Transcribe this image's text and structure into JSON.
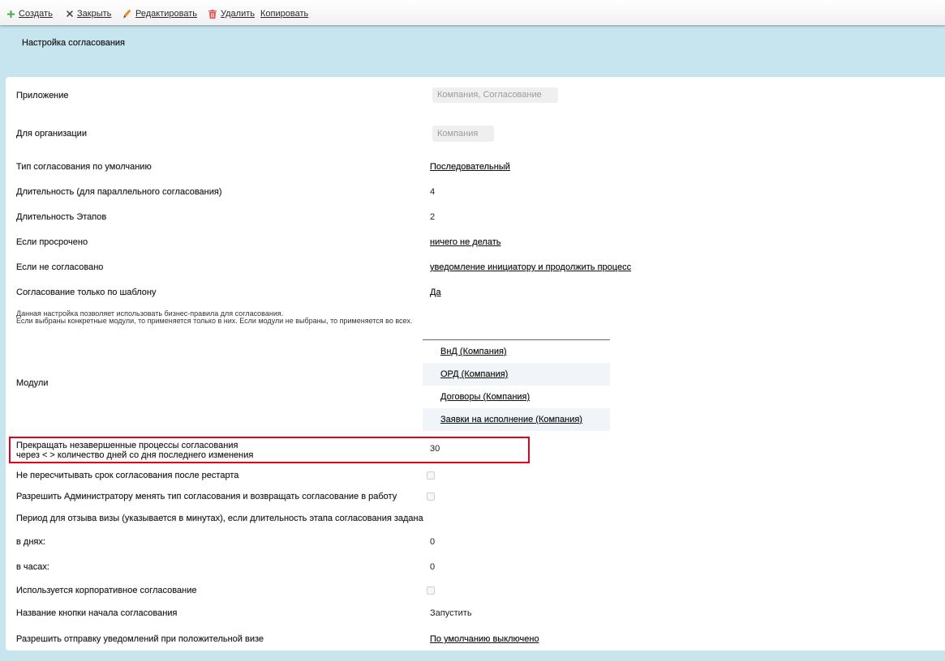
{
  "toolbar": {
    "create": {
      "label": "Создать",
      "icon": "plus-icon"
    },
    "close": {
      "label": "Закрыть",
      "icon": "close-icon"
    },
    "edit": {
      "label": "Редактировать",
      "icon": "pencil-icon"
    },
    "delete": {
      "label": "Удалить",
      "icon": "trash-icon"
    },
    "copy": {
      "label": "Копировать"
    }
  },
  "page": {
    "title": "Настройка согласования"
  },
  "fields": {
    "application": {
      "label": "Приложение",
      "value": "Компания, Согласование"
    },
    "organization": {
      "label": "Для организации",
      "value": "Компания"
    },
    "default_type": {
      "label": "Тип согласования по умолчанию",
      "value": "Последовательный"
    },
    "parallel_duration": {
      "label": "Длительность (для параллельного согласования)",
      "value": "4"
    },
    "stage_duration": {
      "label": "Длительность Этапов",
      "value": "2"
    },
    "if_overdue": {
      "label": "Если просрочено",
      "value": "ничего не делать"
    },
    "if_not_approved": {
      "label": "Если не согласовано",
      "value": "уведомление инициатору и продолжить процесс"
    },
    "template_only": {
      "label": "Согласование только по шаблону",
      "value": "Да"
    },
    "modules_note": {
      "line1": "Данная настройка позволяет использовать бизнес-правила для согласования.",
      "line2": "Если выбраны конкретные модули, то применяется только в них. Если модули не выбраны, то применяется во всех."
    },
    "modules": {
      "label": "Модули",
      "items": [
        "ВнД (Компания)",
        "ОРД (Компания)",
        "Договоры (Компания)",
        "Заявки на исполнение (Компания)"
      ]
    },
    "stop_unfinished": {
      "label_line1": "Прекращать незавершенные процессы согласования",
      "label_line2": "через < > количество дней со дня последнего изменения",
      "value": "30"
    },
    "no_recalc_after_restart": {
      "label": "Не пересчитывать срок согласования после рестарта",
      "checked": false
    },
    "admin_can_change_type": {
      "label": "Разрешить Администратору менять тип согласования и возвращать согласование в работу",
      "checked": false
    },
    "visa_recall_period": {
      "label": "Период для отзыва визы (указывается в минутах), если длительность этапа согласования задана"
    },
    "in_days": {
      "label": "в днях:",
      "value": "0"
    },
    "in_hours": {
      "label": "в часах:",
      "value": "0"
    },
    "corporate_approval": {
      "label": "Используется корпоративное согласование",
      "checked": false
    },
    "start_button_name": {
      "label": "Название кнопки начала согласования",
      "value": "Запустить"
    },
    "positive_visa_notifications": {
      "label": "Разрешить отправку уведомлений при положительной визе",
      "value": "По умолчанию выключено"
    }
  },
  "colors": {
    "page_background": "#c6e5ee",
    "highlight_border": "#e2001a",
    "create_icon": "#4fa84a",
    "edit_icon": "#f0862a",
    "delete_icon": "#e0504a"
  }
}
